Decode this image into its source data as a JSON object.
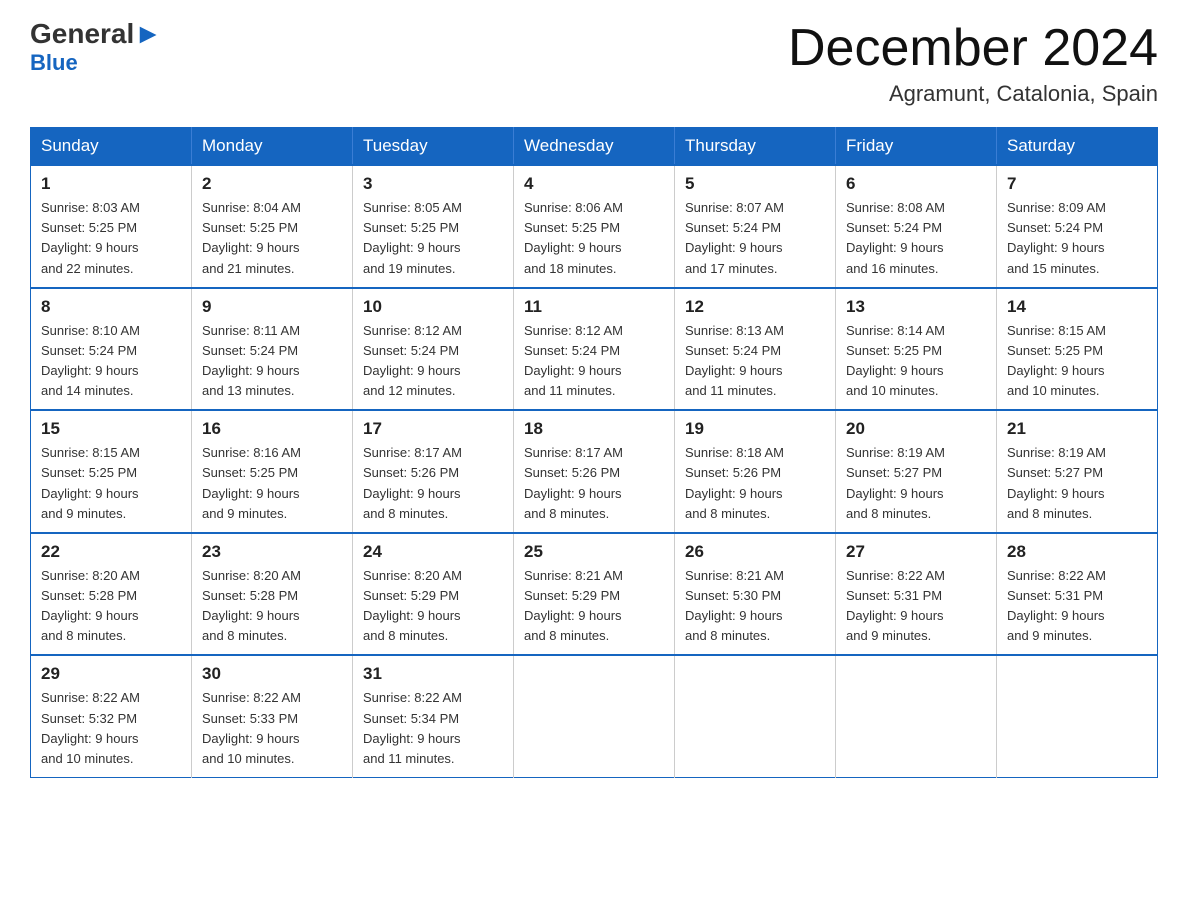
{
  "header": {
    "logo_general": "General",
    "logo_blue": "Blue",
    "month_title": "December 2024",
    "location": "Agramunt, Catalonia, Spain"
  },
  "days_of_week": [
    "Sunday",
    "Monday",
    "Tuesday",
    "Wednesday",
    "Thursday",
    "Friday",
    "Saturday"
  ],
  "weeks": [
    [
      {
        "day": "1",
        "sunrise": "8:03 AM",
        "sunset": "5:25 PM",
        "daylight": "9 hours and 22 minutes."
      },
      {
        "day": "2",
        "sunrise": "8:04 AM",
        "sunset": "5:25 PM",
        "daylight": "9 hours and 21 minutes."
      },
      {
        "day": "3",
        "sunrise": "8:05 AM",
        "sunset": "5:25 PM",
        "daylight": "9 hours and 19 minutes."
      },
      {
        "day": "4",
        "sunrise": "8:06 AM",
        "sunset": "5:25 PM",
        "daylight": "9 hours and 18 minutes."
      },
      {
        "day": "5",
        "sunrise": "8:07 AM",
        "sunset": "5:24 PM",
        "daylight": "9 hours and 17 minutes."
      },
      {
        "day": "6",
        "sunrise": "8:08 AM",
        "sunset": "5:24 PM",
        "daylight": "9 hours and 16 minutes."
      },
      {
        "day": "7",
        "sunrise": "8:09 AM",
        "sunset": "5:24 PM",
        "daylight": "9 hours and 15 minutes."
      }
    ],
    [
      {
        "day": "8",
        "sunrise": "8:10 AM",
        "sunset": "5:24 PM",
        "daylight": "9 hours and 14 minutes."
      },
      {
        "day": "9",
        "sunrise": "8:11 AM",
        "sunset": "5:24 PM",
        "daylight": "9 hours and 13 minutes."
      },
      {
        "day": "10",
        "sunrise": "8:12 AM",
        "sunset": "5:24 PM",
        "daylight": "9 hours and 12 minutes."
      },
      {
        "day": "11",
        "sunrise": "8:12 AM",
        "sunset": "5:24 PM",
        "daylight": "9 hours and 11 minutes."
      },
      {
        "day": "12",
        "sunrise": "8:13 AM",
        "sunset": "5:24 PM",
        "daylight": "9 hours and 11 minutes."
      },
      {
        "day": "13",
        "sunrise": "8:14 AM",
        "sunset": "5:25 PM",
        "daylight": "9 hours and 10 minutes."
      },
      {
        "day": "14",
        "sunrise": "8:15 AM",
        "sunset": "5:25 PM",
        "daylight": "9 hours and 10 minutes."
      }
    ],
    [
      {
        "day": "15",
        "sunrise": "8:15 AM",
        "sunset": "5:25 PM",
        "daylight": "9 hours and 9 minutes."
      },
      {
        "day": "16",
        "sunrise": "8:16 AM",
        "sunset": "5:25 PM",
        "daylight": "9 hours and 9 minutes."
      },
      {
        "day": "17",
        "sunrise": "8:17 AM",
        "sunset": "5:26 PM",
        "daylight": "9 hours and 8 minutes."
      },
      {
        "day": "18",
        "sunrise": "8:17 AM",
        "sunset": "5:26 PM",
        "daylight": "9 hours and 8 minutes."
      },
      {
        "day": "19",
        "sunrise": "8:18 AM",
        "sunset": "5:26 PM",
        "daylight": "9 hours and 8 minutes."
      },
      {
        "day": "20",
        "sunrise": "8:19 AM",
        "sunset": "5:27 PM",
        "daylight": "9 hours and 8 minutes."
      },
      {
        "day": "21",
        "sunrise": "8:19 AM",
        "sunset": "5:27 PM",
        "daylight": "9 hours and 8 minutes."
      }
    ],
    [
      {
        "day": "22",
        "sunrise": "8:20 AM",
        "sunset": "5:28 PM",
        "daylight": "9 hours and 8 minutes."
      },
      {
        "day": "23",
        "sunrise": "8:20 AM",
        "sunset": "5:28 PM",
        "daylight": "9 hours and 8 minutes."
      },
      {
        "day": "24",
        "sunrise": "8:20 AM",
        "sunset": "5:29 PM",
        "daylight": "9 hours and 8 minutes."
      },
      {
        "day": "25",
        "sunrise": "8:21 AM",
        "sunset": "5:29 PM",
        "daylight": "9 hours and 8 minutes."
      },
      {
        "day": "26",
        "sunrise": "8:21 AM",
        "sunset": "5:30 PM",
        "daylight": "9 hours and 8 minutes."
      },
      {
        "day": "27",
        "sunrise": "8:22 AM",
        "sunset": "5:31 PM",
        "daylight": "9 hours and 9 minutes."
      },
      {
        "day": "28",
        "sunrise": "8:22 AM",
        "sunset": "5:31 PM",
        "daylight": "9 hours and 9 minutes."
      }
    ],
    [
      {
        "day": "29",
        "sunrise": "8:22 AM",
        "sunset": "5:32 PM",
        "daylight": "9 hours and 10 minutes."
      },
      {
        "day": "30",
        "sunrise": "8:22 AM",
        "sunset": "5:33 PM",
        "daylight": "9 hours and 10 minutes."
      },
      {
        "day": "31",
        "sunrise": "8:22 AM",
        "sunset": "5:34 PM",
        "daylight": "9 hours and 11 minutes."
      },
      null,
      null,
      null,
      null
    ]
  ],
  "labels": {
    "sunrise": "Sunrise:",
    "sunset": "Sunset:",
    "daylight": "Daylight:"
  }
}
